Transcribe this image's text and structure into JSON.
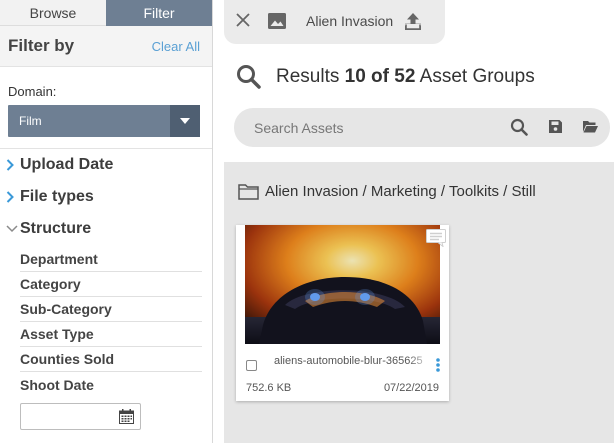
{
  "tabs": {
    "browse": "Browse",
    "filter": "Filter"
  },
  "filter_panel": {
    "title": "Filter by",
    "clear_all": "Clear All",
    "domain_label": "Domain:",
    "domain_value": "Film",
    "sections": {
      "upload_date": "Upload Date",
      "file_types": "File types",
      "structure": "Structure"
    },
    "structure_items": [
      "Department",
      "Category",
      "Sub-Category",
      "Asset Type",
      "Counties Sold",
      "Shoot Date"
    ],
    "date_input_value": ""
  },
  "header": {
    "chip_title": "Alien Invasion",
    "results_prefix": "Results",
    "results_count": "10 of 52",
    "results_suffix": "Asset Groups",
    "search_placeholder": "Search Assets"
  },
  "breadcrumb": "Alien Invasion / Marketing / Toolkits / Still",
  "assets": [
    {
      "filename": "aliens-automobile-blur-365625",
      "size": "752.6 KB",
      "date": "07/22/2019"
    }
  ],
  "colors": {
    "filter_tab": "#6e7f93",
    "link_blue": "#5aa0d4",
    "accent_blue": "#3a99d8",
    "content_bg": "#e6e6e6"
  }
}
